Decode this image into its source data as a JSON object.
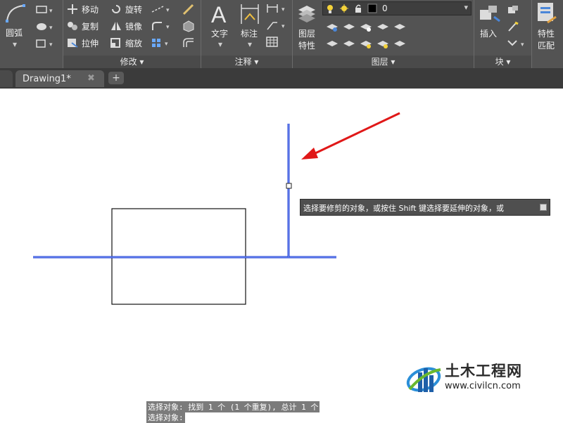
{
  "ribbon": {
    "draw_panel": {
      "arc_label": "圆弧"
    },
    "modify_panel": {
      "title": "修改",
      "move": "移动",
      "rotate": "旋转",
      "copy": "复制",
      "mirror": "镜像",
      "stretch": "拉伸",
      "scale": "缩放"
    },
    "annotation_panel": {
      "title": "注释",
      "text_label": "文字",
      "dimension_label": "标注"
    },
    "layers_panel": {
      "title": "图层",
      "layer_props_label_1": "图层",
      "layer_props_label_2": "特性",
      "layer_value": "0"
    },
    "block_panel": {
      "title": "块",
      "insert_label": "插入"
    },
    "properties_panel": {
      "match_label_1": "特性",
      "match_label_2": "匹配"
    }
  },
  "tabs": {
    "active_tab": "Drawing1*",
    "close_symbol": "✖",
    "new_tab_symbol": "+"
  },
  "canvas": {
    "tooltip_text": "选择要修剪的对象，或按住 Shift 键选择要延伸的对象，或",
    "command_history": [
      "选择对象: 找到 1 个 (1 个重复), 总计 1 个",
      "选择对象:"
    ]
  },
  "watermark": {
    "name": "土木工程网",
    "url": "www.civilcn.com"
  },
  "colors": {
    "ribbon_bg": "#535353",
    "line_blue": "#1f3fd0",
    "arrow_red": "#e01818"
  }
}
